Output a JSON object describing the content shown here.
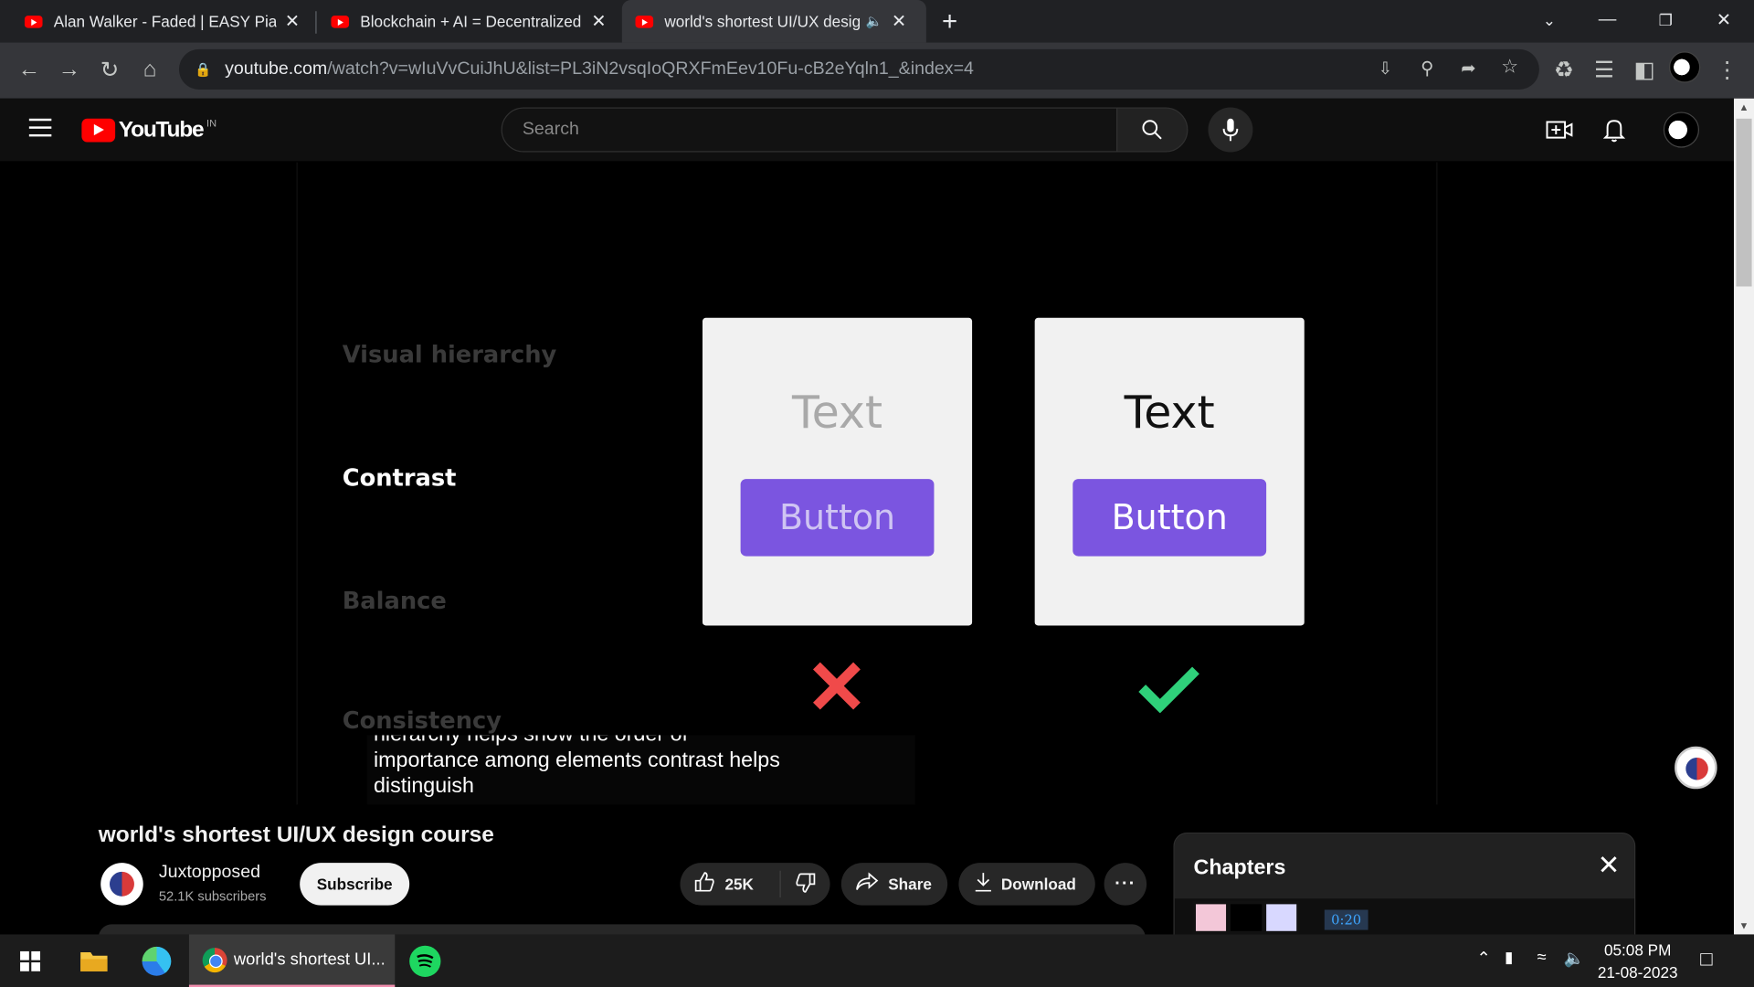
{
  "browser": {
    "tabs": [
      {
        "title": "Alan Walker - Faded | EASY Piano",
        "close": "✕"
      },
      {
        "title": "Blockchain + AI = Decentralized A",
        "close": "✕"
      },
      {
        "title": "world's shortest UI/UX design",
        "close": "✕",
        "active": true,
        "audio_icon": "speaker-icon"
      }
    ],
    "new_tab": "+",
    "url_host": "youtube.com",
    "url_path": "/watch?v=wIuVvCuiJhU&list=PL3iN2vsqIoQRXFmEev10Fu-cB2eYqln1_&index=4"
  },
  "youtube": {
    "logo_text": "YouTube",
    "country_code": "IN",
    "search_placeholder": "Search"
  },
  "video": {
    "labels": [
      "Visual hierarchy",
      "Contrast",
      "Balance",
      "Consistency"
    ],
    "active_label": "Contrast",
    "card_text": "Text",
    "card_button": "Button",
    "bad_mark": "✖",
    "good_mark": "✔",
    "caption_lines": [
      "hierarchy helps show the order of",
      "importance among elements contrast helps",
      "distinguish"
    ]
  },
  "meta": {
    "title": "world's shortest UI/UX design course",
    "channel": "Juxtopposed",
    "subscribers": "52.1K subscribers",
    "subscribe": "Subscribe",
    "likes": "25K",
    "share": "Share",
    "download": "Download",
    "more": "···"
  },
  "chapters": {
    "title": "Chapters",
    "close": "✕",
    "first_time": "0:20"
  },
  "taskbar": {
    "app_title": "world's shortest UI...",
    "time": "05:08 PM",
    "date": "21-08-2023"
  },
  "colors": {
    "accent_purple": "#7b55e0",
    "bad_red": "#f04a4a",
    "good_green": "#2fd07a",
    "youtube_red": "#ff0000"
  }
}
